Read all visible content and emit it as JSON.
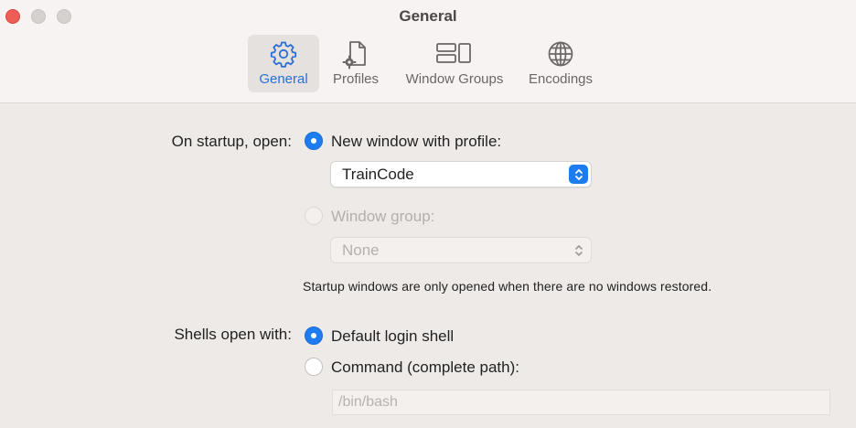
{
  "window": {
    "title": "General"
  },
  "tabs": [
    {
      "label": "General",
      "icon": "gear-icon",
      "active": true
    },
    {
      "label": "Profiles",
      "icon": "profile-document-icon",
      "active": false
    },
    {
      "label": "Window Groups",
      "icon": "window-groups-icon",
      "active": false
    },
    {
      "label": "Encodings",
      "icon": "globe-icon",
      "active": false
    }
  ],
  "startup": {
    "label": "On startup, open:",
    "option_profile": {
      "label": "New window with profile:",
      "selected": true
    },
    "profile_popup": {
      "value": "TrainCode",
      "enabled": true
    },
    "option_group": {
      "label": "Window group:",
      "selected": false,
      "enabled": false
    },
    "group_popup": {
      "value": "None",
      "enabled": false
    },
    "note": "Startup windows are only opened when there are no windows restored."
  },
  "shells": {
    "label": "Shells open with:",
    "option_default": {
      "label": "Default login shell",
      "selected": true
    },
    "option_command": {
      "label": "Command (complete path):",
      "selected": false
    },
    "command_field": {
      "value": "",
      "placeholder": "/bin/bash"
    }
  },
  "colors": {
    "accent": "#1c7cf0",
    "close": "#ee5d56"
  }
}
